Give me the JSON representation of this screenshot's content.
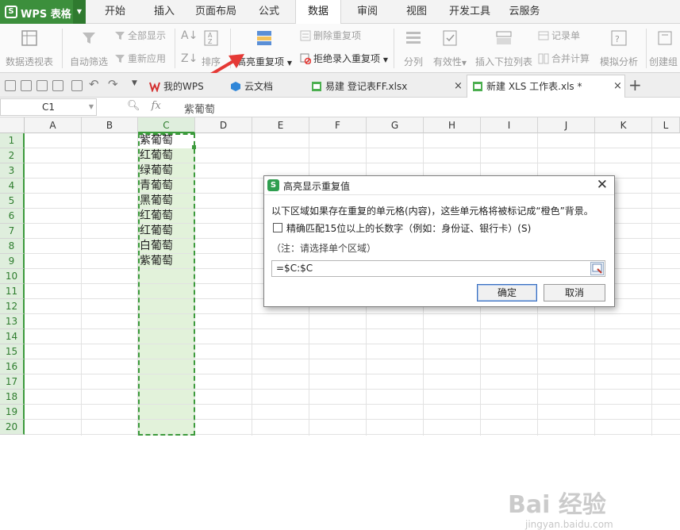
{
  "app": {
    "name": "WPS 表格",
    "logo": "S"
  },
  "menu_tabs": [
    "开始",
    "插入",
    "页面布局",
    "公式",
    "数据",
    "审阅",
    "视图",
    "开发工具",
    "云服务"
  ],
  "active_tab": "数据",
  "ribbon": {
    "pivot": "数据透视表",
    "autofilter": "自动筛选",
    "show_all": "全部显示",
    "reapply": "重新应用",
    "sort": "排序",
    "highlight_dup": "高亮重复项",
    "remove_dup": "删除重复项",
    "reject_dup": "拒绝录入重复项",
    "split": "分列",
    "validity": "有效性",
    "dropdown": "插入下拉列表",
    "record": "记录单",
    "consolidate": "合并计算",
    "simulate": "模拟分析",
    "create_group": "创建组"
  },
  "doc_tabs": [
    {
      "label": "我的WPS"
    },
    {
      "label": "云文档"
    },
    {
      "label": "易建 登记表FF.xlsx"
    },
    {
      "label": "新建 XLS 工作表.xls *"
    }
  ],
  "formula_bar": {
    "cell_ref": "C1",
    "fx": "fx",
    "content": "紫葡萄"
  },
  "columns": [
    "A",
    "B",
    "C",
    "D",
    "E",
    "F",
    "G",
    "H",
    "I",
    "J",
    "K",
    "L"
  ],
  "rows": [
    "1",
    "2",
    "3",
    "4",
    "5",
    "6",
    "7",
    "8",
    "9",
    "10",
    "11",
    "12",
    "13",
    "14",
    "15",
    "16",
    "17",
    "18",
    "19",
    "20"
  ],
  "column_c_values": [
    "紫葡萄",
    "红葡萄",
    "绿葡萄",
    "青葡萄",
    "黑葡萄",
    "红葡萄",
    "红葡萄",
    "白葡萄",
    "紫葡萄"
  ],
  "dialog": {
    "title": "高亮显示重复值",
    "description": "以下区域如果存在重复的单元格(内容)，这些单元格将被标记成“橙色”背景。",
    "checkbox_label": "精确匹配15位以上的长数字（例如：身份证、银行卡）(S)",
    "note": "（注：请选择单个区域）",
    "range_value": "=$C:$C",
    "ok_label": "确定",
    "cancel_label": "取消"
  },
  "watermark": {
    "brand": "Bai  经验",
    "url": "jingyan.baidu.com"
  },
  "colors": {
    "accent": "#3c9a3c",
    "selection_fill": "#e2f2da",
    "arrow": "#e53935"
  }
}
